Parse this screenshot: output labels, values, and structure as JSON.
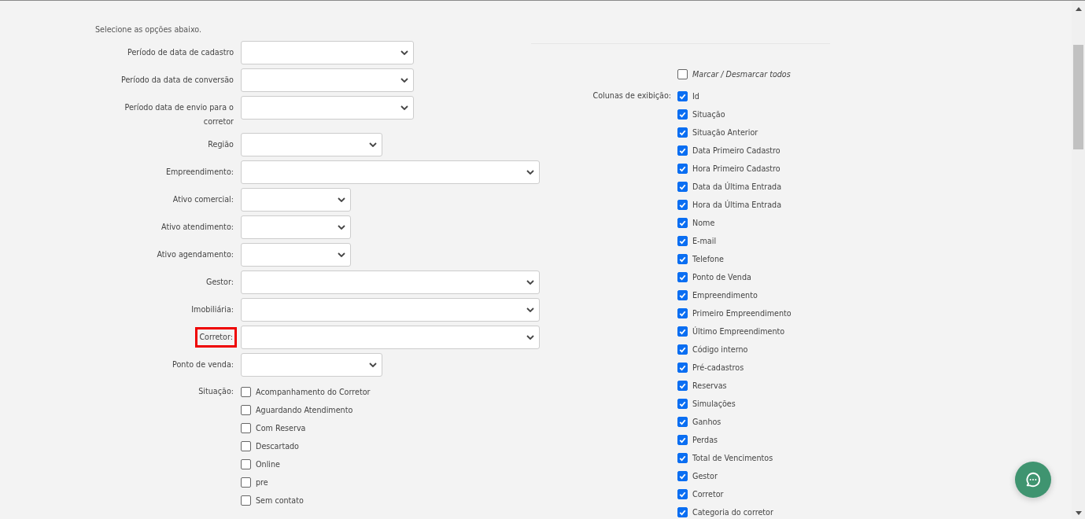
{
  "intro": "Selecione as opções abaixo.",
  "filters": [
    {
      "label": "Período de data de cadastro",
      "highlighted": false
    },
    {
      "label": "Período da data de conversão",
      "highlighted": false
    },
    {
      "label": "Período data de envio para o corretor",
      "highlighted": false
    },
    {
      "label": "Região",
      "highlighted": false
    },
    {
      "label": "Empreendimento:",
      "highlighted": false
    },
    {
      "label": "Ativo comercial:",
      "highlighted": false
    },
    {
      "label": "Ativo atendimento:",
      "highlighted": false
    },
    {
      "label": "Ativo agendamento:",
      "highlighted": false
    },
    {
      "label": "Gestor:",
      "highlighted": false
    },
    {
      "label": "Imobiliária:",
      "highlighted": false
    },
    {
      "label": "Corretor:",
      "highlighted": true
    },
    {
      "label": "Ponto de venda:",
      "highlighted": false
    }
  ],
  "situacao": {
    "label": "Situação:",
    "options": [
      {
        "label": "Acompanhamento do Corretor",
        "checked": false
      },
      {
        "label": "Aguardando Atendimento",
        "checked": false
      },
      {
        "label": "Com Reserva",
        "checked": false
      },
      {
        "label": "Descartado",
        "checked": false
      },
      {
        "label": "Online",
        "checked": false
      },
      {
        "label": "pre",
        "checked": false
      },
      {
        "label": "Sem contato",
        "checked": false
      }
    ]
  },
  "columns": {
    "toggle_all": {
      "label": "Marcar / Desmarcar todos",
      "checked": false
    },
    "label": "Colunas de exibição:",
    "options": [
      {
        "label": "Id",
        "checked": true
      },
      {
        "label": "Situação",
        "checked": true
      },
      {
        "label": "Situação Anterior",
        "checked": true
      },
      {
        "label": "Data Primeiro Cadastro",
        "checked": true
      },
      {
        "label": "Hora Primeiro Cadastro",
        "checked": true
      },
      {
        "label": "Data da Última Entrada",
        "checked": true
      },
      {
        "label": "Hora da Última Entrada",
        "checked": true
      },
      {
        "label": "Nome",
        "checked": true
      },
      {
        "label": "E-mail",
        "checked": true
      },
      {
        "label": "Telefone",
        "checked": true
      },
      {
        "label": "Ponto de Venda",
        "checked": true
      },
      {
        "label": "Empreendimento",
        "checked": true
      },
      {
        "label": "Primeiro Empreendimento",
        "checked": true
      },
      {
        "label": "Último Empreendimento",
        "checked": true
      },
      {
        "label": "Código interno",
        "checked": true
      },
      {
        "label": "Pré-cadastros",
        "checked": true
      },
      {
        "label": "Reservas",
        "checked": true
      },
      {
        "label": "Simulações",
        "checked": true
      },
      {
        "label": "Ganhos",
        "checked": true
      },
      {
        "label": "Perdas",
        "checked": true
      },
      {
        "label": "Total de Vencimentos",
        "checked": true
      },
      {
        "label": "Gestor",
        "checked": true
      },
      {
        "label": "Corretor",
        "checked": true
      },
      {
        "label": "Categoria do corretor",
        "checked": true
      }
    ]
  }
}
